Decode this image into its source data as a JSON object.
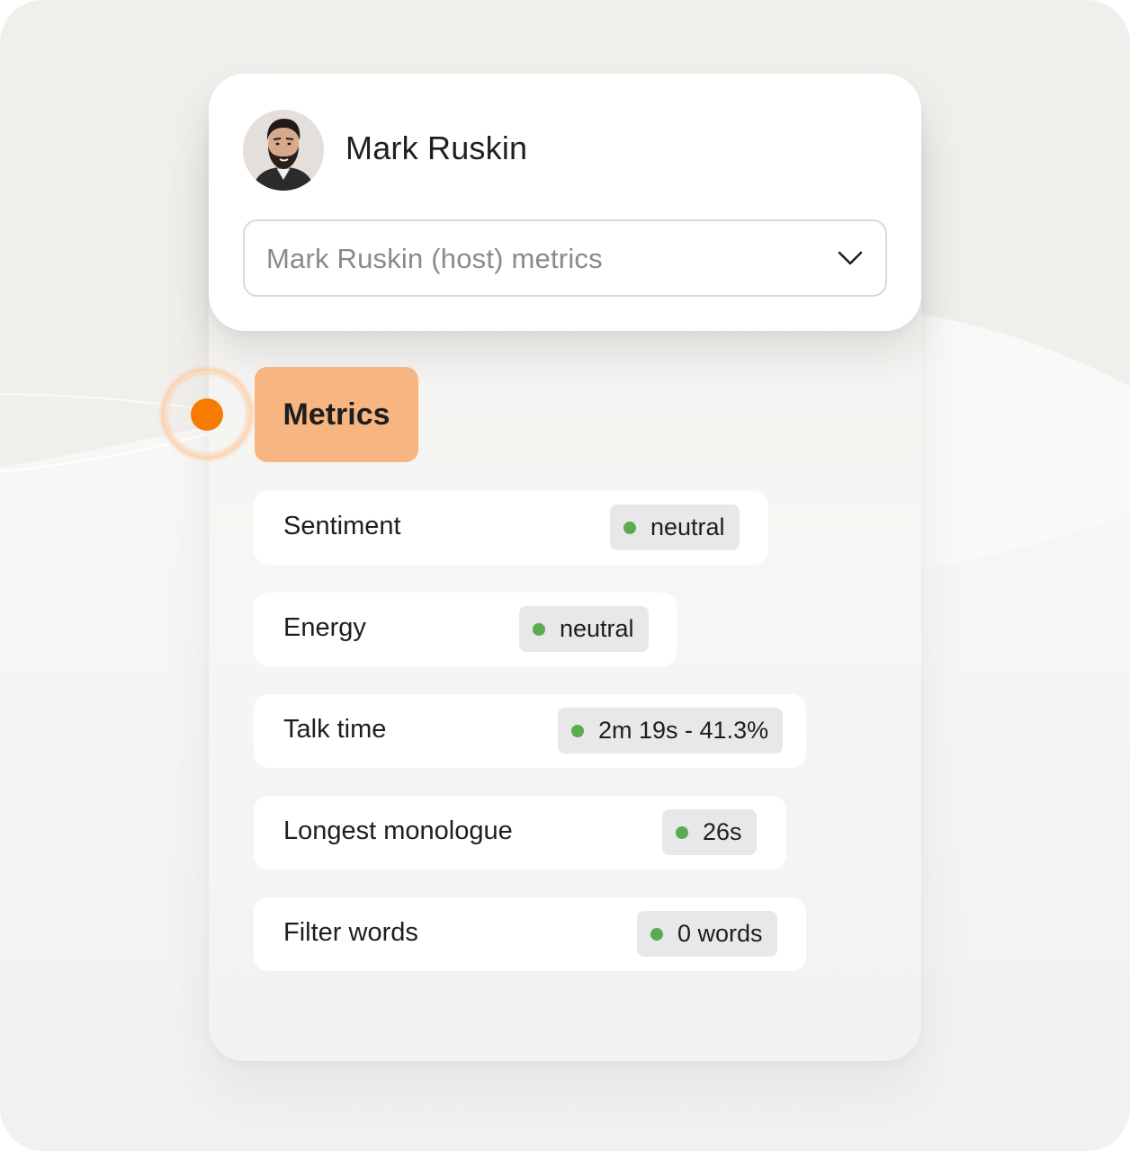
{
  "profile": {
    "name": "Mark Ruskin",
    "avatar_icon": "person-photo-avatar"
  },
  "selector": {
    "value": "Mark Ruskin (host) metrics",
    "icon": "chevron-down-icon"
  },
  "section": {
    "label": "Metrics",
    "indicator_color": "#f57c00",
    "tag_color": "#f7b681"
  },
  "colors": {
    "status_positive": "#5aac4e",
    "pill_background": "#e8e8ea"
  },
  "metrics": [
    {
      "label": "Sentiment",
      "value": "neutral",
      "status": "green"
    },
    {
      "label": "Energy",
      "value": "neutral",
      "status": "green"
    },
    {
      "label": "Talk time",
      "value": "2m 19s - 41.3%",
      "status": "green"
    },
    {
      "label": "Longest monologue",
      "value": "26s",
      "status": "green"
    },
    {
      "label": "Filter words",
      "value": "0 words",
      "status": "green"
    }
  ]
}
